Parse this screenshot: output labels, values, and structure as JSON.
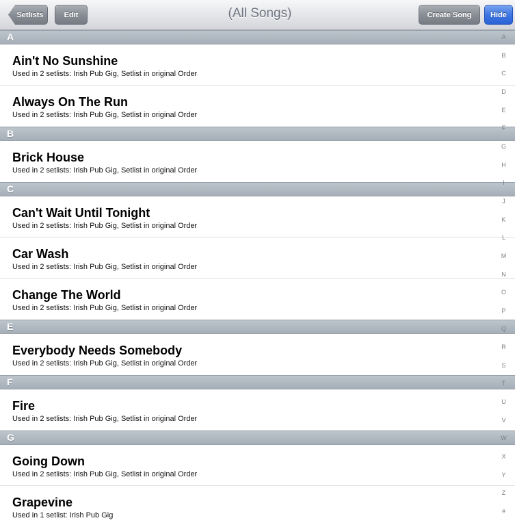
{
  "navbar": {
    "back_label": "Setlists",
    "edit_label": "Edit",
    "title": "(All Songs)",
    "create_label": "Create Song",
    "hide_label": "Hide"
  },
  "sections": [
    {
      "letter": "A",
      "songs": [
        {
          "title": "Ain't No Sunshine",
          "subtitle": "Used in 2 setlists: Irish Pub Gig, Setlist in original Order"
        },
        {
          "title": "Always On The Run",
          "subtitle": "Used in 2 setlists: Irish Pub Gig, Setlist in original Order"
        }
      ]
    },
    {
      "letter": "B",
      "songs": [
        {
          "title": "Brick House",
          "subtitle": "Used in 2 setlists: Irish Pub Gig, Setlist in original Order"
        }
      ]
    },
    {
      "letter": "C",
      "songs": [
        {
          "title": "Can't Wait Until Tonight",
          "subtitle": "Used in 2 setlists: Irish Pub Gig, Setlist in original Order"
        },
        {
          "title": "Car Wash",
          "subtitle": "Used in 2 setlists: Irish Pub Gig, Setlist in original Order"
        },
        {
          "title": "Change The World",
          "subtitle": "Used in 2 setlists: Irish Pub Gig, Setlist in original Order"
        }
      ]
    },
    {
      "letter": "E",
      "songs": [
        {
          "title": "Everybody Needs Somebody",
          "subtitle": "Used in 2 setlists: Irish Pub Gig, Setlist in original Order"
        }
      ]
    },
    {
      "letter": "F",
      "songs": [
        {
          "title": "Fire",
          "subtitle": "Used in 2 setlists: Irish Pub Gig, Setlist in original Order"
        }
      ]
    },
    {
      "letter": "G",
      "songs": [
        {
          "title": "Going Down",
          "subtitle": "Used in 2 setlists: Irish Pub Gig, Setlist in original Order"
        },
        {
          "title": "Grapevine",
          "subtitle": "Used in 1 setlist: Irish Pub Gig"
        }
      ]
    }
  ],
  "index_letters": [
    "A",
    "B",
    "C",
    "D",
    "E",
    "F",
    "G",
    "H",
    "I",
    "J",
    "K",
    "L",
    "M",
    "N",
    "O",
    "P",
    "Q",
    "R",
    "S",
    "T",
    "U",
    "V",
    "W",
    "X",
    "Y",
    "Z",
    "#"
  ]
}
